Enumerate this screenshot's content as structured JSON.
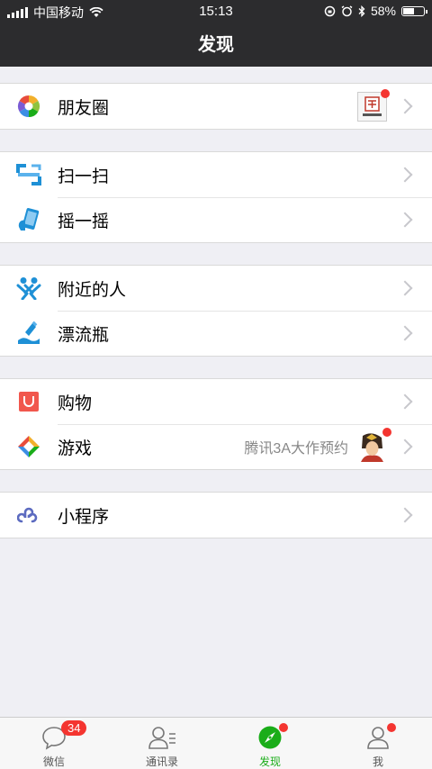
{
  "status": {
    "carrier": "中国移动",
    "time": "15:13",
    "battery": "58%",
    "battery_level": 0.58
  },
  "navbar": {
    "title": "发现"
  },
  "groups": [
    [
      {
        "label": "朋友圈",
        "icon": "moments-aperture-icon"
      }
    ],
    [
      {
        "label": "扫一扫",
        "icon": "scan-icon"
      },
      {
        "label": "摇一摇",
        "icon": "shake-phone-icon"
      }
    ],
    [
      {
        "label": "附近的人",
        "icon": "people-nearby-icon"
      },
      {
        "label": "漂流瓶",
        "icon": "drift-bottle-icon"
      }
    ],
    [
      {
        "label": "购物",
        "icon": "shopping-bag-icon"
      },
      {
        "label": "游戏",
        "icon": "games-icon",
        "extra": "腾讯3A大作预约"
      }
    ],
    [
      {
        "label": "小程序",
        "icon": "mini-program-icon"
      }
    ]
  ],
  "tabs": [
    {
      "label": "微信",
      "icon": "chat-bubble-icon",
      "badge": "34"
    },
    {
      "label": "通讯录",
      "icon": "contacts-icon"
    },
    {
      "label": "发现",
      "icon": "compass-icon"
    },
    {
      "label": "我",
      "icon": "profile-icon"
    }
  ],
  "colors": {
    "active_tab": "#1aad19",
    "badge": "#f43530",
    "bar": "#2c2c2e"
  }
}
